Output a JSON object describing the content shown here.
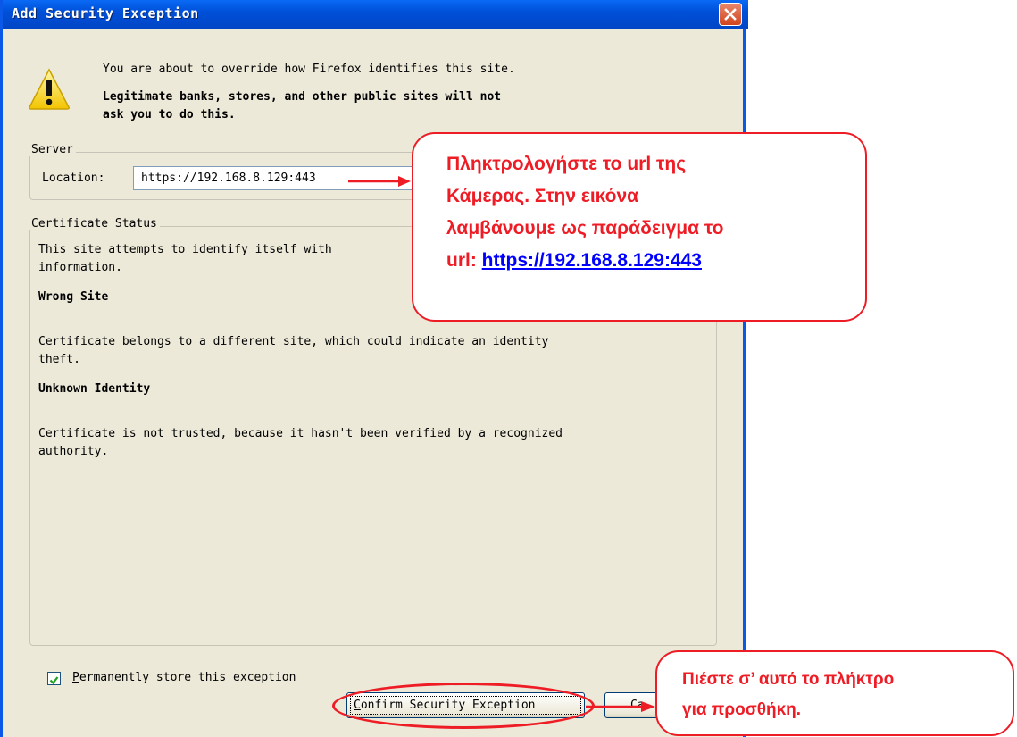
{
  "dialog": {
    "title": "Add Security Exception",
    "intro_line": "You are about to override how Firefox identifies this site.",
    "warning_line1": "Legitimate banks, stores, and other public sites will not",
    "warning_line2": "ask you to do this."
  },
  "server": {
    "legend": "Server",
    "location_label": "Location:",
    "location_value": "https://192.168.8.129:443"
  },
  "certificate": {
    "legend": "Certificate Status",
    "line1": "This site attempts to identify itself with",
    "line2": "information.",
    "wrong_site_heading": "Wrong Site",
    "wrong_site_text1": "Certificate belongs to a different site, which could indicate an identity",
    "wrong_site_text2": "theft.",
    "unknown_heading": "Unknown Identity",
    "unknown_text1": "Certificate is not trusted, because it hasn't been verified by a recognized",
    "unknown_text2": "authority."
  },
  "permanent": {
    "checked": true,
    "label_first": "P",
    "label_rest": "ermanently store this exception"
  },
  "buttons": {
    "confirm_first": "C",
    "confirm_rest": "onfirm Security Exception",
    "cancel_visible": "Ca"
  },
  "callouts": {
    "url": {
      "line1": "Πληκτρολογήστε το url της",
      "line2": "Κάμερας. Στην εικόνα",
      "line3": "λαμβάνουμε ως παράδειγμα το",
      "line4_prefix": "url: ",
      "line4_link": "https://192.168.8.129:443"
    },
    "button": {
      "line1": "Πιέστε σ’ αυτό το πλήκτρο",
      "line2": "για προσθήκη."
    }
  },
  "colors": {
    "annotation_red": "#ee1c25",
    "link_blue": "#0000ff",
    "titlebar_blue": "#0054e3",
    "dialog_bg": "#ece9d8"
  }
}
